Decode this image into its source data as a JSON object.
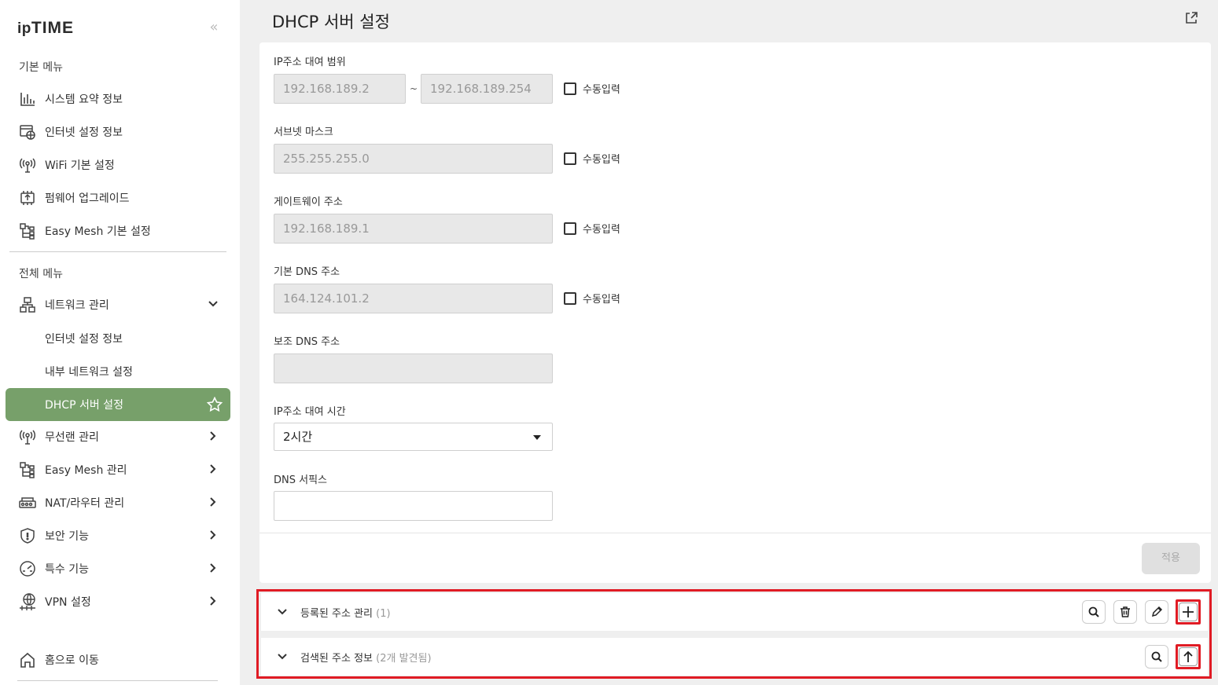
{
  "app": {
    "logo_prefix": "ip",
    "logo_main": "TIME"
  },
  "sidebar": {
    "basic_menu_title": "기본 메뉴",
    "basic_items": [
      {
        "label": "시스템 요약 정보",
        "icon": "bar-chart-icon"
      },
      {
        "label": "인터넷 설정 정보",
        "icon": "internet-settings-icon"
      },
      {
        "label": "WiFi 기본 설정",
        "icon": "wifi-antenna-icon"
      },
      {
        "label": "펌웨어 업그레이드",
        "icon": "firmware-chip-icon"
      },
      {
        "label": "Easy Mesh 기본 설정",
        "icon": "mesh-icon"
      }
    ],
    "all_menu_title": "전체 메뉴",
    "network_group": {
      "label": "네트워크 관리",
      "icon": "network-icon",
      "expanded": true
    },
    "network_sub": [
      {
        "label": "인터넷 설정 정보"
      },
      {
        "label": "내부 네트워크 설정"
      },
      {
        "label": "DHCP 서버 설정",
        "active": true
      }
    ],
    "other_items": [
      {
        "label": "무선랜 관리",
        "icon": "wifi-antenna-icon"
      },
      {
        "label": "Easy Mesh 관리",
        "icon": "mesh-icon"
      },
      {
        "label": "NAT/라우터 관리",
        "icon": "router-icon"
      },
      {
        "label": "보안 기능",
        "icon": "shield-icon"
      },
      {
        "label": "특수 기능",
        "icon": "gauge-icon"
      },
      {
        "label": "VPN 설정",
        "icon": "globe-network-icon"
      }
    ],
    "home_label": "홈으로 이동"
  },
  "main": {
    "title": "DHCP 서버 설정",
    "fields": {
      "ip_range_label": "IP주소 대여 범위",
      "ip_range_start": "192.168.189.2",
      "ip_range_sep": "~",
      "ip_range_end": "192.168.189.254",
      "subnet_label": "서브넷 마스크",
      "subnet_value": "255.255.255.0",
      "gateway_label": "게이트웨이 주소",
      "gateway_value": "192.168.189.1",
      "dns1_label": "기본 DNS 주소",
      "dns1_value": "164.124.101.2",
      "dns2_label": "보조 DNS 주소",
      "dns2_value": "",
      "lease_label": "IP주소 대여 시간",
      "lease_value": "2시간",
      "suffix_label": "DNS 서픽스",
      "suffix_value": "",
      "manual_label": "수동입력"
    },
    "apply_label": "적용"
  },
  "panels": {
    "registered": {
      "title": "등록된 주소 관리",
      "count": "(1)"
    },
    "discovered": {
      "title": "검색된 주소 정보",
      "count": "(2개 발견됨)"
    }
  },
  "colors": {
    "active_menu": "#77a06a",
    "highlight": "#e01b24"
  }
}
